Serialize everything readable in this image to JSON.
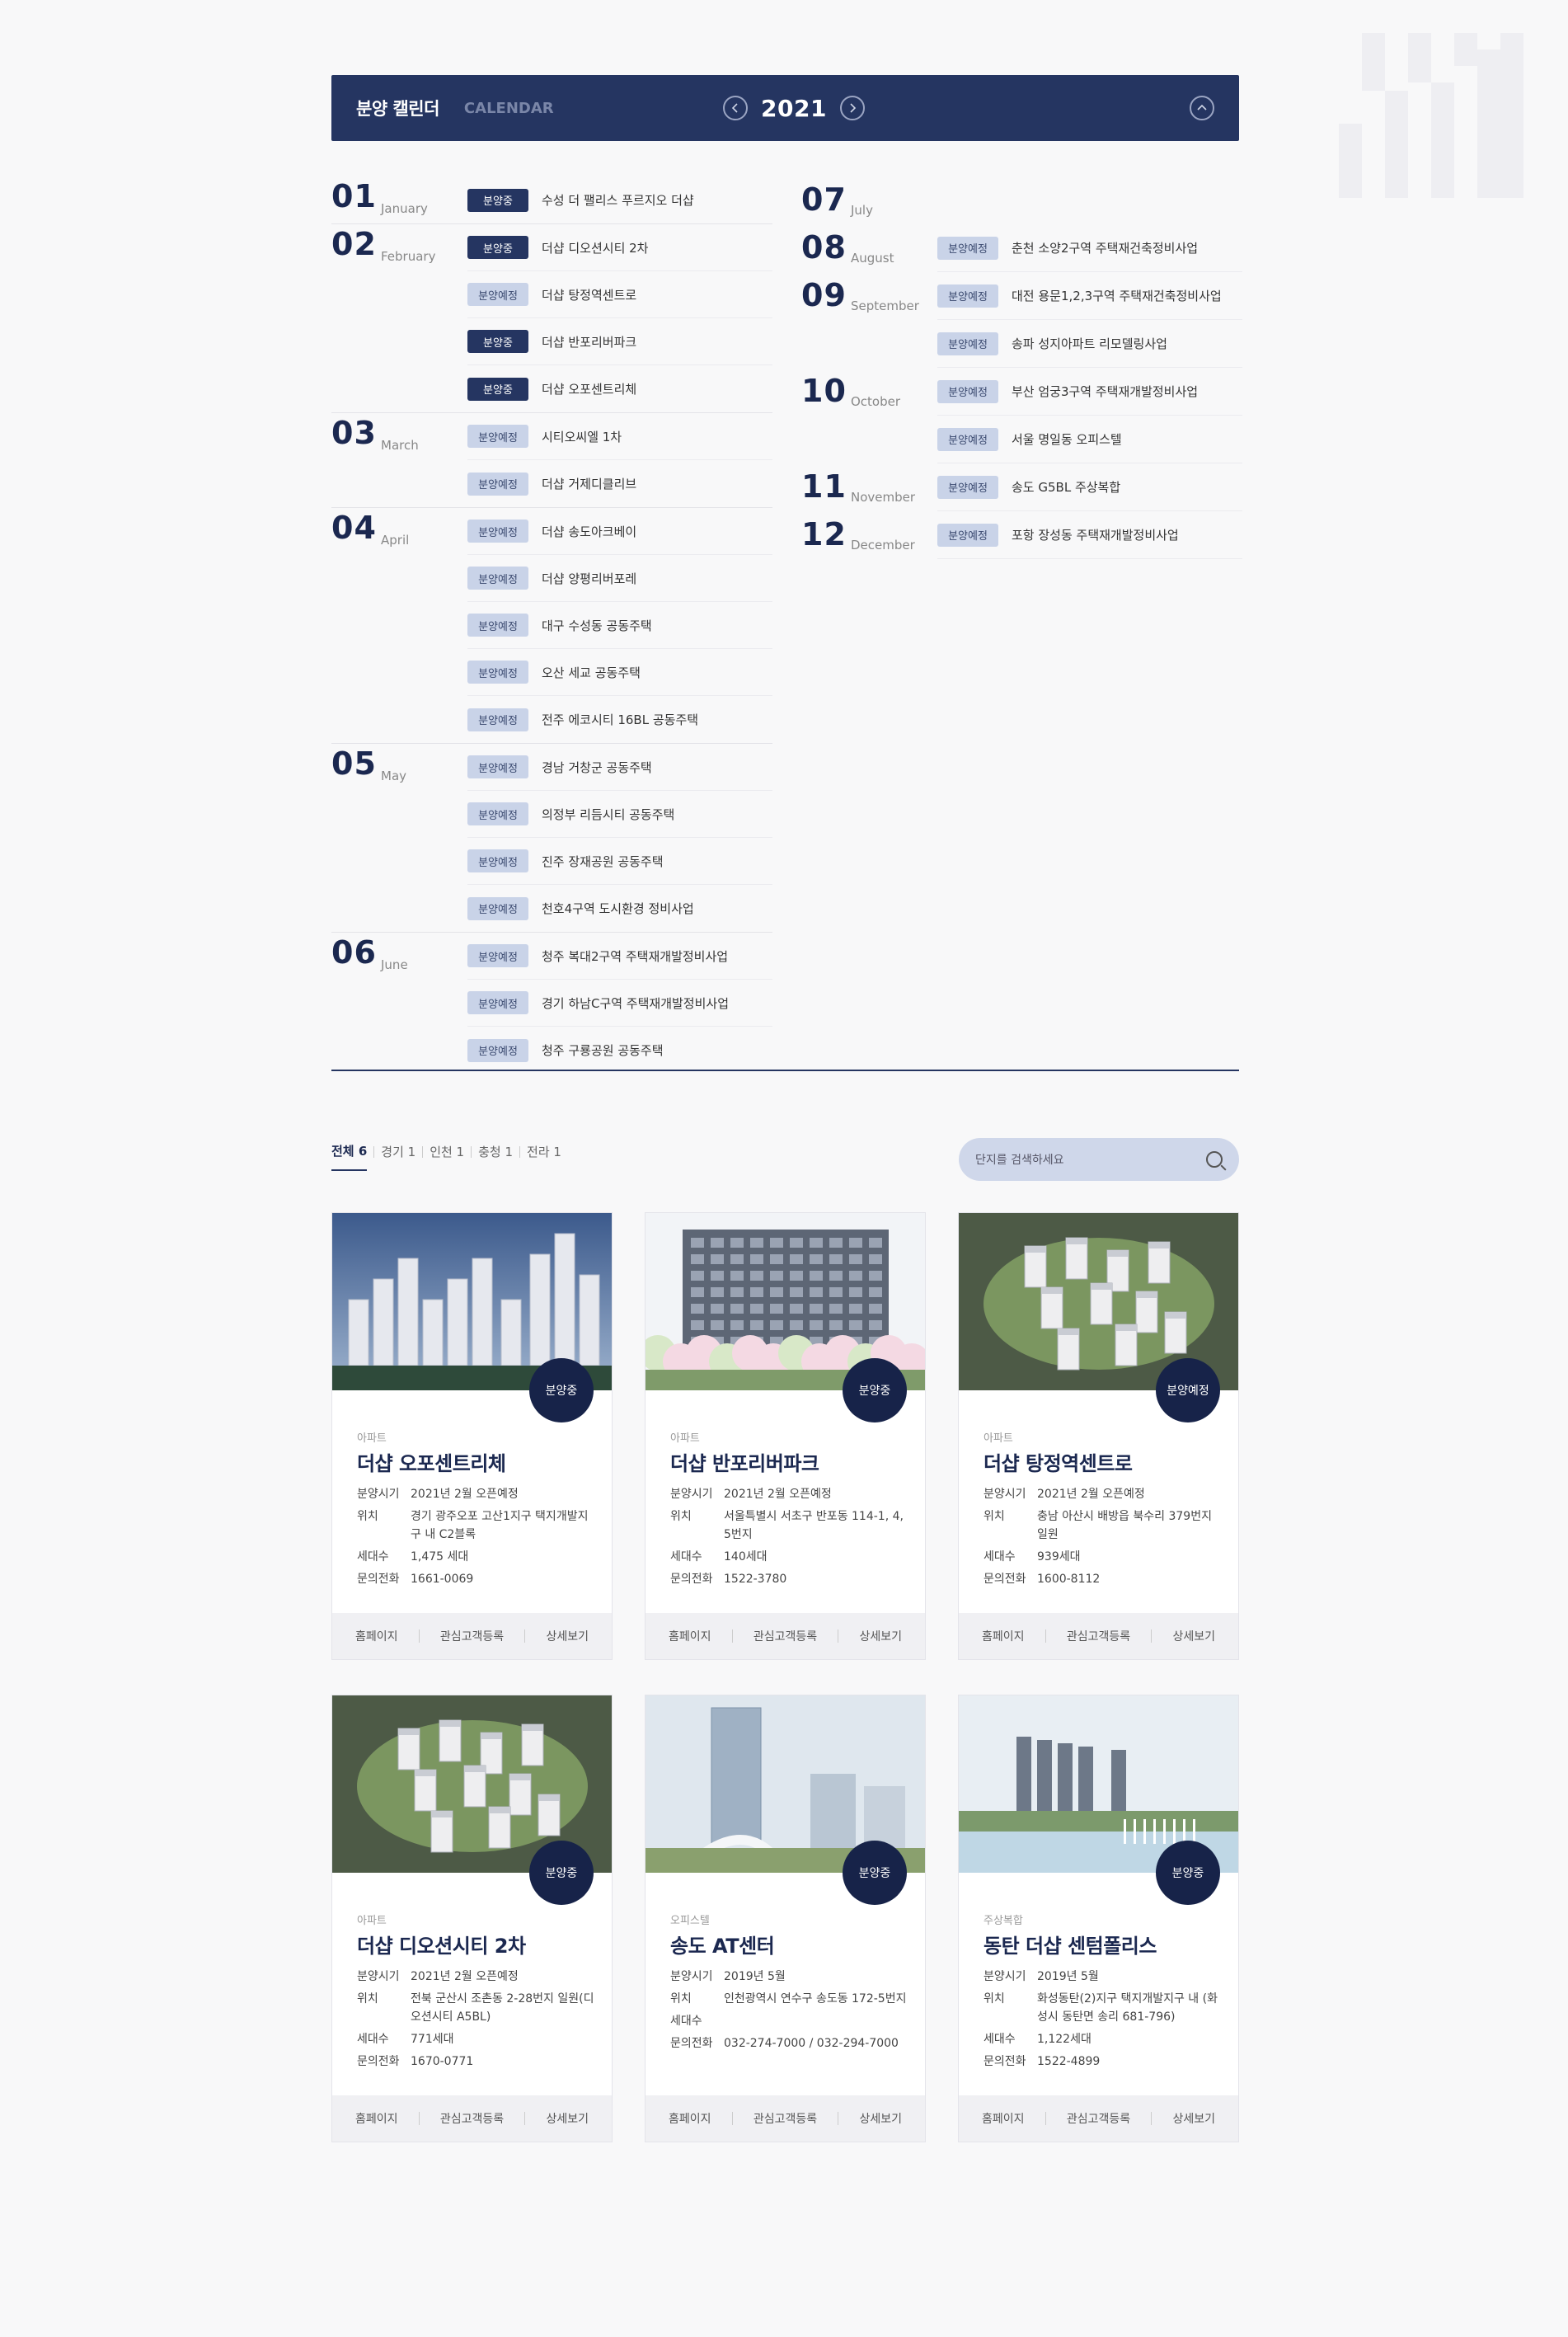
{
  "calendar": {
    "title": "분양 캘린더",
    "subtitle": "CALENDAR",
    "year": "2021",
    "prev_icon": "‹",
    "next_icon": "›",
    "collapse_icon": "^",
    "left_months": [
      {
        "num": "01",
        "name": "January",
        "events": [
          {
            "badge": "분양중",
            "type": "on",
            "name": "수성 더 팰리스 푸르지오 더샵"
          }
        ]
      },
      {
        "num": "02",
        "name": "February",
        "events": [
          {
            "badge": "분양중",
            "type": "on",
            "name": "더샵 디오션시티 2차"
          },
          {
            "badge": "분양예정",
            "type": "plan",
            "name": "더샵 탕정역센트로"
          },
          {
            "badge": "분양중",
            "type": "on",
            "name": "더샵 반포리버파크"
          },
          {
            "badge": "분양중",
            "type": "on",
            "name": "더샵 오포센트리체"
          }
        ]
      },
      {
        "num": "03",
        "name": "March",
        "events": [
          {
            "badge": "분양예정",
            "type": "plan",
            "name": "시티오씨엘 1차"
          },
          {
            "badge": "분양예정",
            "type": "plan",
            "name": "더샵 거제디클리브"
          }
        ]
      },
      {
        "num": "04",
        "name": "April",
        "events": [
          {
            "badge": "분양예정",
            "type": "plan",
            "name": "더샵 송도아크베이"
          },
          {
            "badge": "분양예정",
            "type": "plan",
            "name": "더샵 양평리버포레"
          },
          {
            "badge": "분양예정",
            "type": "plan",
            "name": "대구 수성동 공동주택"
          },
          {
            "badge": "분양예정",
            "type": "plan",
            "name": "오산 세교 공동주택"
          },
          {
            "badge": "분양예정",
            "type": "plan",
            "name": "전주 에코시티 16BL 공동주택"
          }
        ]
      },
      {
        "num": "05",
        "name": "May",
        "events": [
          {
            "badge": "분양예정",
            "type": "plan",
            "name": "경남 거창군 공동주택"
          },
          {
            "badge": "분양예정",
            "type": "plan",
            "name": "의정부 리듬시티 공동주택"
          },
          {
            "badge": "분양예정",
            "type": "plan",
            "name": "진주 장재공원 공동주택"
          },
          {
            "badge": "분양예정",
            "type": "plan",
            "name": "천호4구역 도시환경 정비사업"
          }
        ]
      },
      {
        "num": "06",
        "name": "June",
        "events": [
          {
            "badge": "분양예정",
            "type": "plan",
            "name": "청주 복대2구역 주택재개발정비사업"
          },
          {
            "badge": "분양예정",
            "type": "plan",
            "name": "경기 하남C구역 주택재개발정비사업"
          },
          {
            "badge": "분양예정",
            "type": "plan",
            "name": "청주 구룡공원 공동주택"
          }
        ]
      }
    ],
    "right_months": [
      {
        "num": "07",
        "name": "July",
        "events": []
      },
      {
        "num": "08",
        "name": "August",
        "events": [
          {
            "badge": "분양예정",
            "type": "plan",
            "name": "춘천 소양2구역 주택재건축정비사업"
          }
        ]
      },
      {
        "num": "09",
        "name": "September",
        "events": [
          {
            "badge": "분양예정",
            "type": "plan",
            "name": "대전 용문1,2,3구역 주택재건축정비사업"
          },
          {
            "badge": "분양예정",
            "type": "plan",
            "name": "송파 성지아파트 리모델링사업"
          }
        ]
      },
      {
        "num": "10",
        "name": "October",
        "events": [
          {
            "badge": "분양예정",
            "type": "plan",
            "name": "부산 엄궁3구역 주택재개발정비사업"
          },
          {
            "badge": "분양예정",
            "type": "plan",
            "name": "서울 명일동 오피스텔"
          }
        ]
      },
      {
        "num": "11",
        "name": "November",
        "events": [
          {
            "badge": "분양예정",
            "type": "plan",
            "name": "송도 G5BL 주상복합"
          }
        ]
      },
      {
        "num": "12",
        "name": "December",
        "events": [
          {
            "badge": "분양예정",
            "type": "plan",
            "name": "포항 장성동 주택재개발정비사업"
          }
        ]
      }
    ]
  },
  "filters": {
    "tabs": [
      {
        "label": "전체",
        "count": "6",
        "active": true
      },
      {
        "label": "경기",
        "count": "1"
      },
      {
        "label": "인천",
        "count": "1"
      },
      {
        "label": "충청",
        "count": "1"
      },
      {
        "label": "전라",
        "count": "1"
      }
    ],
    "search_placeholder": "단지를 검색하세요"
  },
  "cards": [
    {
      "status": "분양중",
      "type": "아파트",
      "title": "더샵 오포센트리체",
      "info": [
        [
          "분양시기",
          "2021년 2월 오픈예정"
        ],
        [
          "위치",
          "경기 광주오포 고산1지구 택지개발지구 내 C2블록"
        ],
        [
          "세대수",
          "1,475 세대"
        ],
        [
          "문의전화",
          "1661-0069"
        ]
      ],
      "scene": "highrise-sky"
    },
    {
      "status": "분양중",
      "type": "아파트",
      "title": "더샵 반포리버파크",
      "info": [
        [
          "분양시기",
          "2021년 2월 오픈예정"
        ],
        [
          "위치",
          "서울특별시 서초구 반포동 114-1, 4, 5번지"
        ],
        [
          "세대수",
          "140세대"
        ],
        [
          "문의전화",
          "1522-3780"
        ]
      ],
      "scene": "lowrise-trees"
    },
    {
      "status": "분양예정",
      "type": "아파트",
      "title": "더샵 탕정역센트로",
      "info": [
        [
          "분양시기",
          "2021년 2월 오픈예정"
        ],
        [
          "위치",
          "충남 아산시 배방읍 북수리 379번지 일원"
        ],
        [
          "세대수",
          "939세대"
        ],
        [
          "문의전화",
          "1600-8112"
        ]
      ],
      "scene": "aerial-green"
    },
    {
      "status": "분양중",
      "type": "아파트",
      "title": "더샵 디오션시티 2차",
      "info": [
        [
          "분양시기",
          "2021년 2월 오픈예정"
        ],
        [
          "위치",
          "전북 군산시 조촌동 2-28번지 일원(디오션시티 A5BL)"
        ],
        [
          "세대수",
          "771세대"
        ],
        [
          "문의전화",
          "1670-0771"
        ]
      ],
      "scene": "aerial-green"
    },
    {
      "status": "분양중",
      "type": "오피스텔",
      "title": "송도 AT센터",
      "info": [
        [
          "분양시기",
          "2019년 5월"
        ],
        [
          "위치",
          "인천광역시 연수구 송도동 172-5번지"
        ],
        [
          "세대수",
          ""
        ],
        [
          "문의전화",
          "032-274-7000 / 032-294-7000"
        ]
      ],
      "scene": "office-sky"
    },
    {
      "status": "분양중",
      "type": "주상복합",
      "title": "동탄 더샵 센텀폴리스",
      "info": [
        [
          "분양시기",
          "2019년 5월"
        ],
        [
          "위치",
          "화성동탄(2)지구 택지개발지구 내 (화성시 동탄면 송리 681-796)"
        ],
        [
          "세대수",
          "1,122세대"
        ],
        [
          "문의전화",
          "1522-4899"
        ]
      ],
      "scene": "lake-towers"
    }
  ],
  "card_footer": {
    "home": "홈페이지",
    "register": "관심고객등록",
    "detail": "상세보기"
  }
}
